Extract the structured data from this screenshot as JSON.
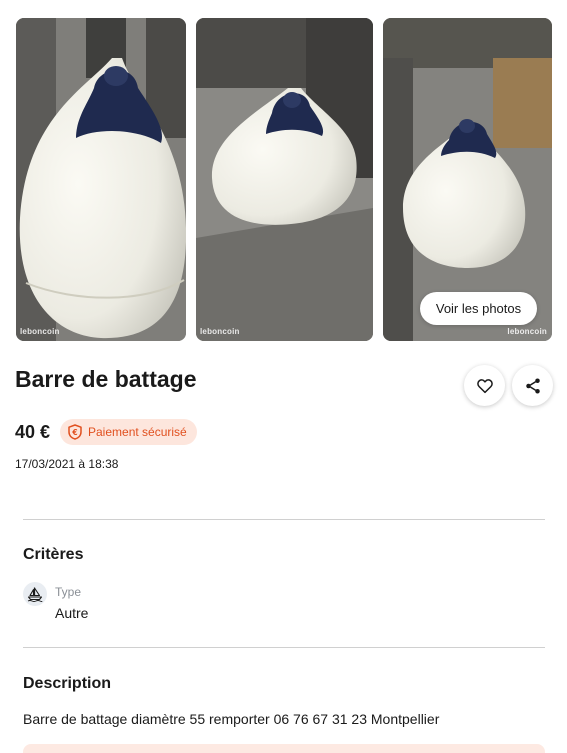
{
  "gallery": {
    "watermark": "leboncoin",
    "see_photos_label": "Voir les photos"
  },
  "listing": {
    "title": "Barre de battage",
    "price": "40 €",
    "secure_payment_label": "Paiement sécurisé",
    "posted_date": "17/03/2021 à 18:38"
  },
  "criteria": {
    "heading": "Critères",
    "items": [
      {
        "icon": "boat-icon",
        "key": "Type",
        "value": "Autre"
      }
    ]
  },
  "description": {
    "heading": "Description",
    "text": "Barre de battage diamètre 55 remporter 06 76 67 31 23 Montpellier"
  },
  "colors": {
    "accent": "#e1501f",
    "badge_bg": "#fde6dd",
    "fender_cap": "#1f2a4f",
    "fender_body": "#efeee6"
  }
}
